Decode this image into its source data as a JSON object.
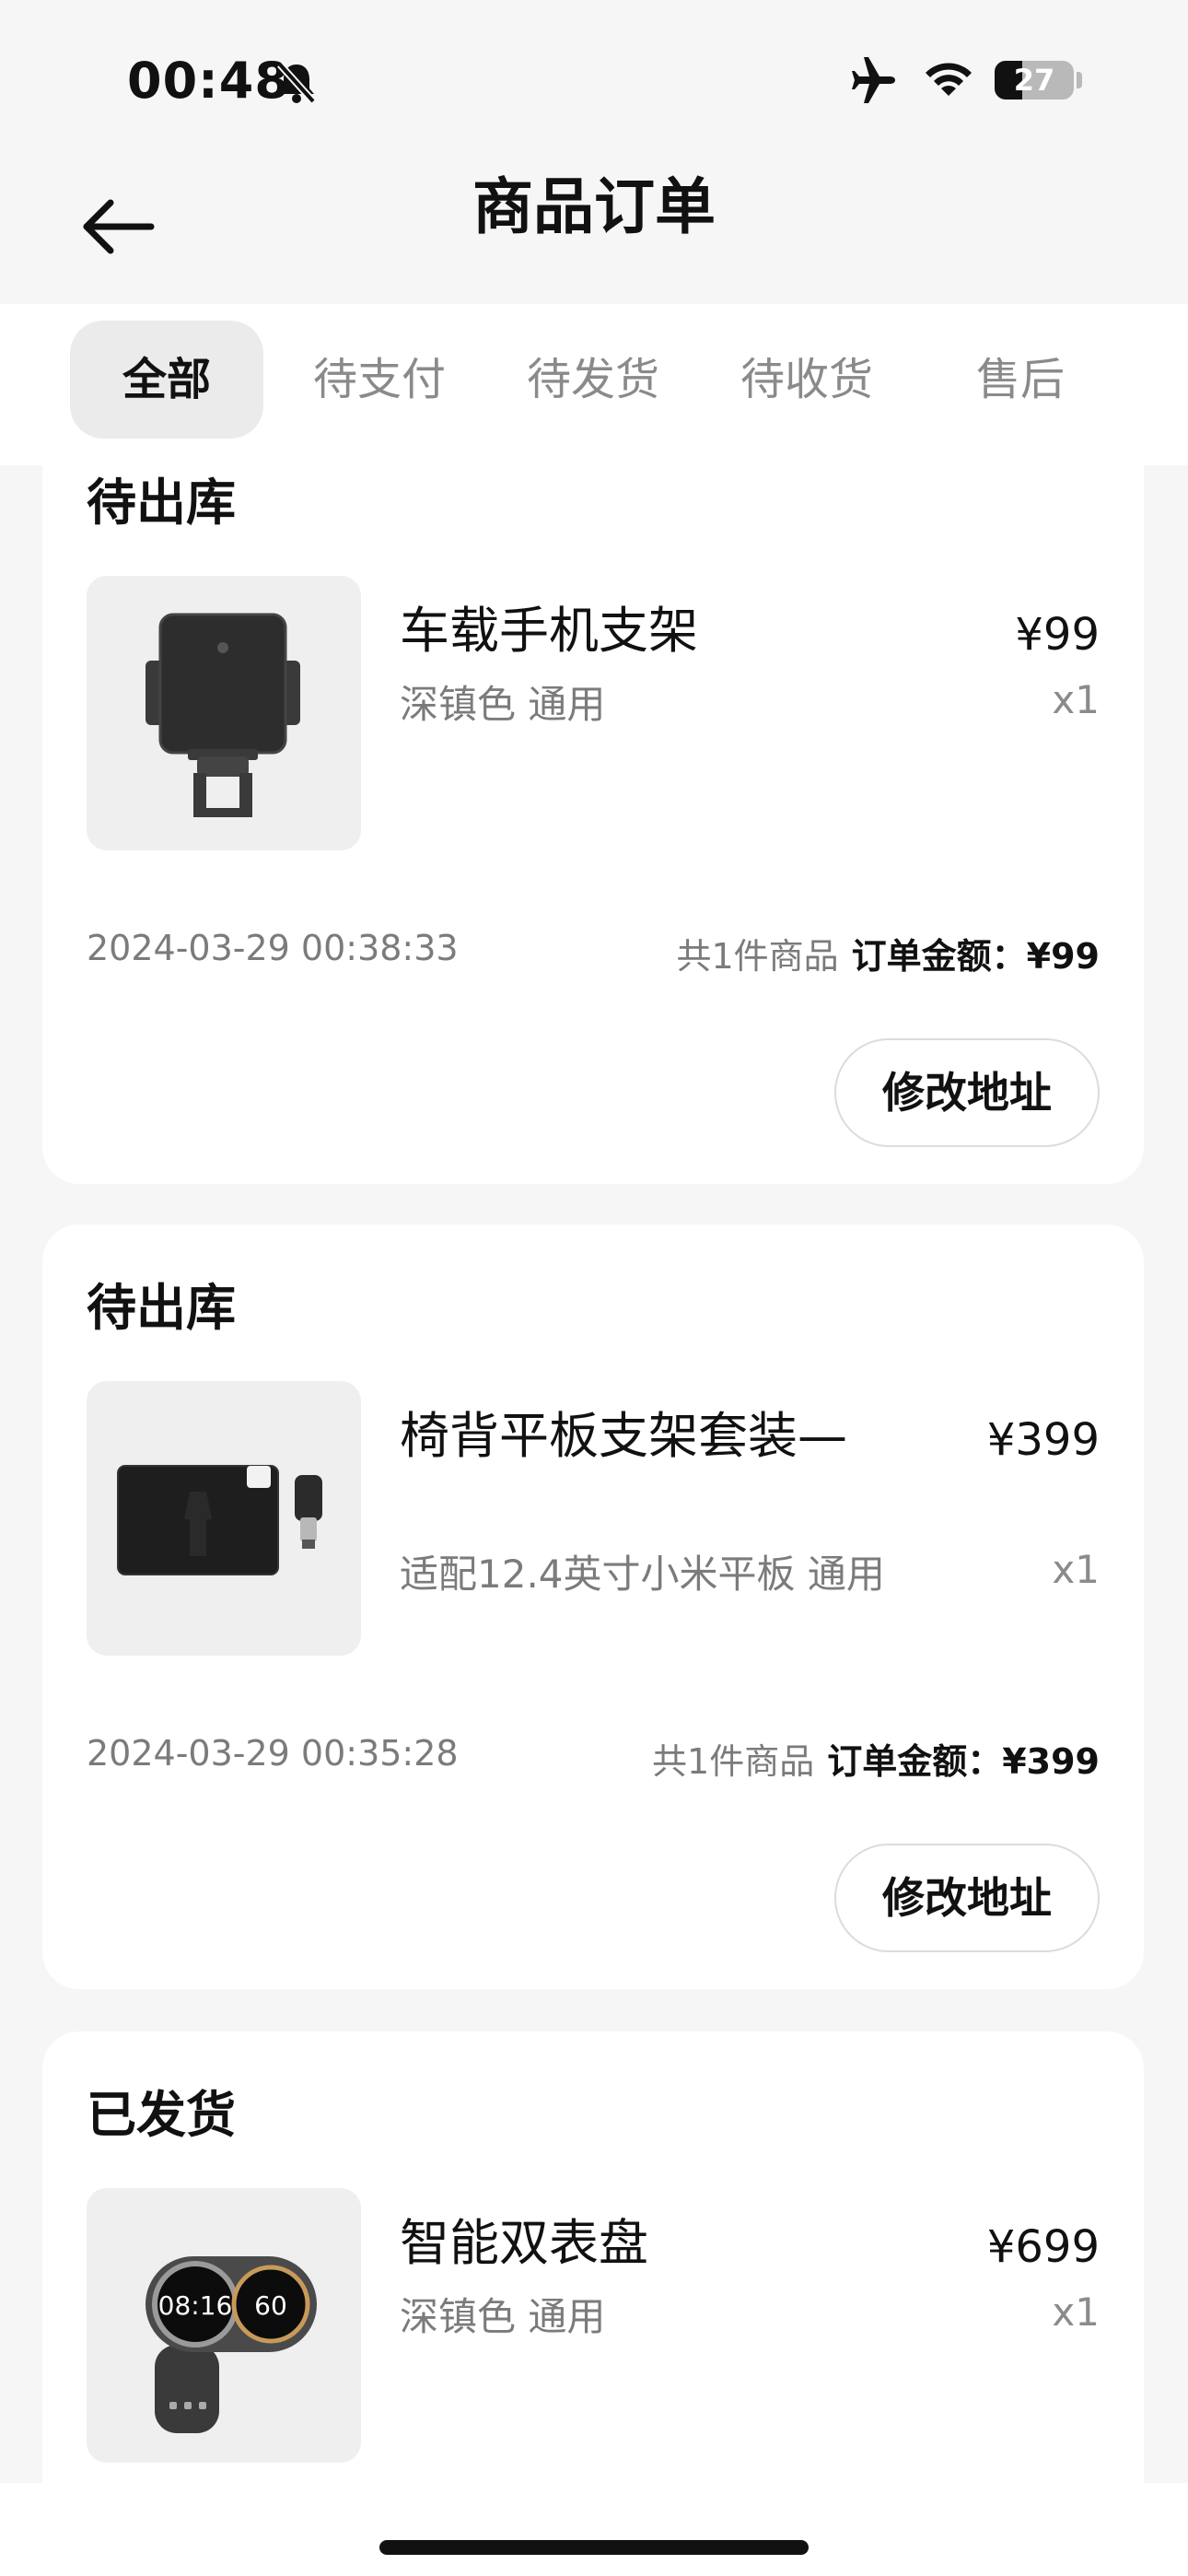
{
  "status_bar": {
    "time": "00:48",
    "battery": "27",
    "icons": [
      "bell-slash-icon",
      "airplane-icon",
      "wifi-icon",
      "battery-icon"
    ]
  },
  "header": {
    "title": "商品订单",
    "back_icon": "arrow-left-icon"
  },
  "tabs": [
    {
      "label": "全部",
      "active": true
    },
    {
      "label": "待支付",
      "active": false
    },
    {
      "label": "待发货",
      "active": false
    },
    {
      "label": "待收货",
      "active": false
    },
    {
      "label": "售后",
      "active": false
    }
  ],
  "orders": [
    {
      "status": "待出库",
      "product_name": "车载手机支架",
      "spec": "深镇色 通用",
      "price": "¥99",
      "qty": "x1",
      "time": "2024-03-29 00:38:33",
      "count": "共1件商品",
      "amount_label": "订单金额：",
      "amount": "¥99",
      "button": "修改地址"
    },
    {
      "status": "待出库",
      "product_name": "椅背平板支架套装—",
      "spec": "适配12.4英寸小米平板 通用",
      "price": "¥399",
      "qty": "x1",
      "time": "2024-03-29 00:35:28",
      "count": "共1件商品",
      "amount_label": "订单金额：",
      "amount": "¥399",
      "button": "修改地址"
    },
    {
      "status": "已发货",
      "product_name": "智能双表盘",
      "spec": "深镇色 通用",
      "price": "¥699",
      "qty": "x1",
      "gauge_left": "08:16",
      "gauge_right": "60"
    }
  ],
  "colors": {
    "background": "#f6f6f6",
    "card": "#ffffff",
    "secondary_text": "#7b7b7b",
    "active_tab_bg": "#ebebeb"
  }
}
